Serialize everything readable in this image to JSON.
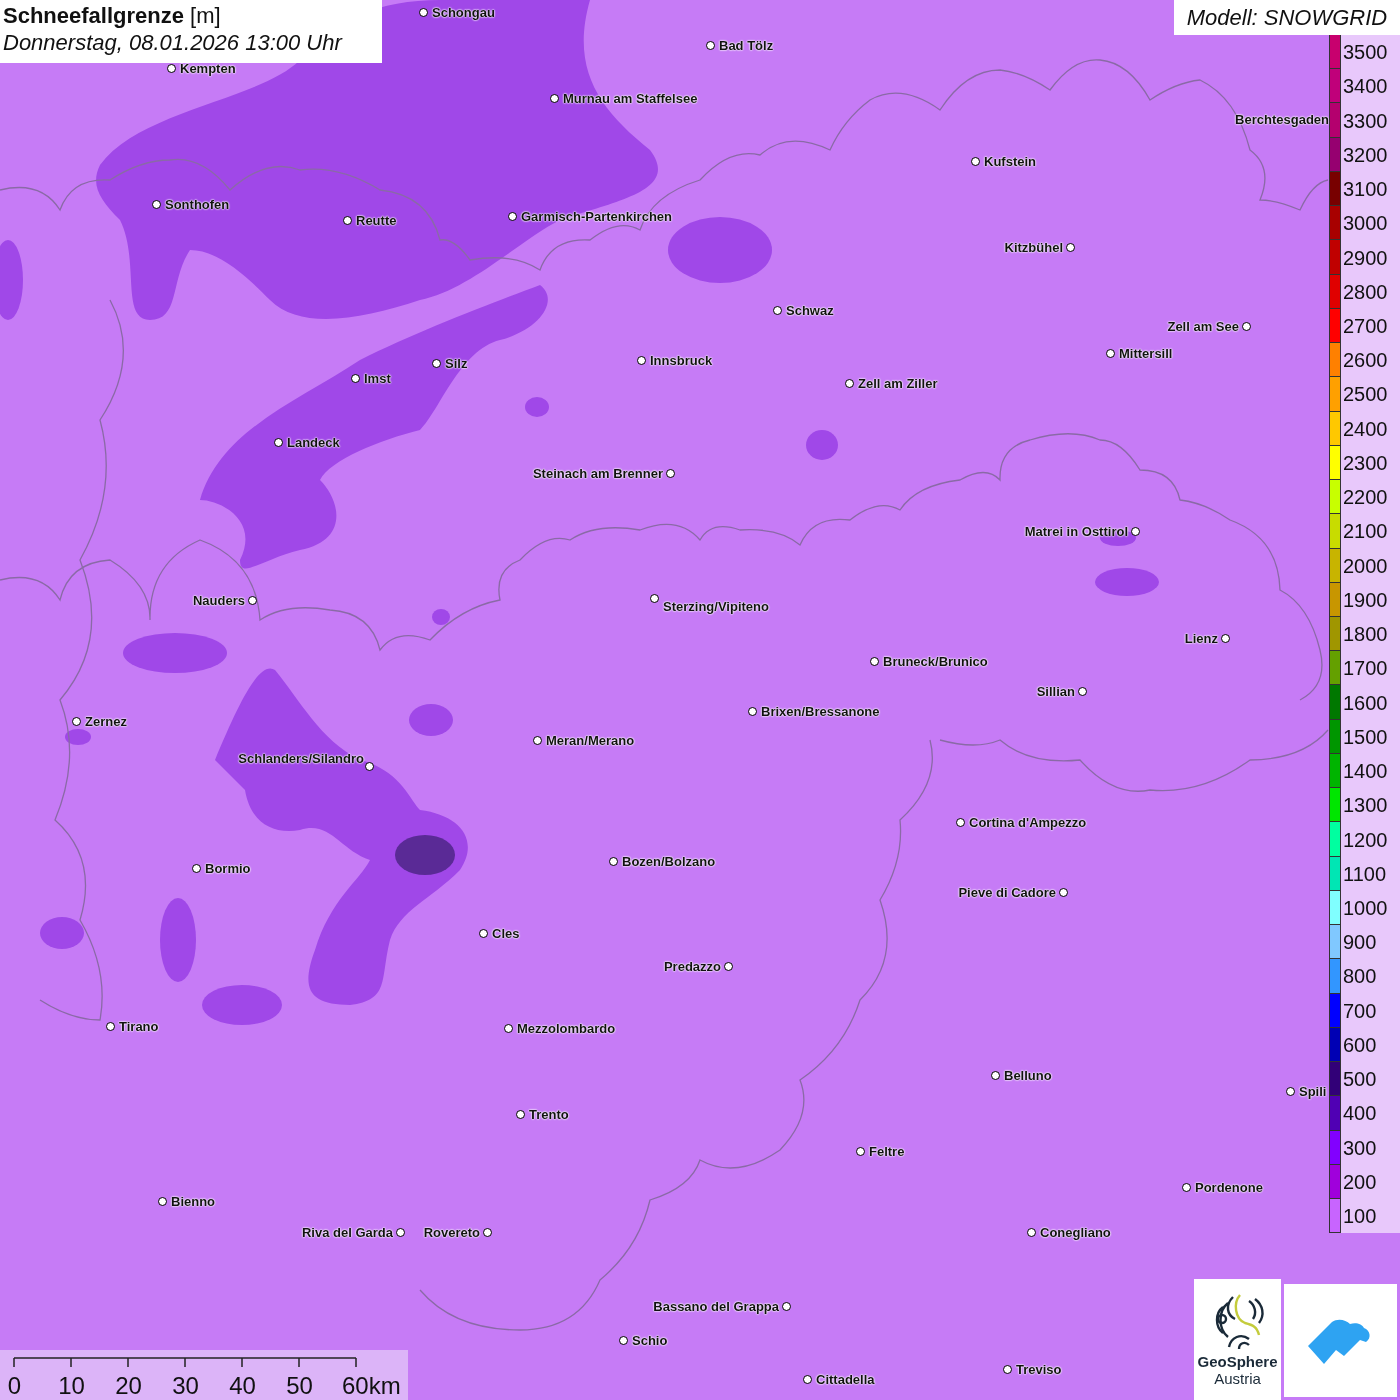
{
  "title": {
    "heading": "**Schneefallgrenze** [m]",
    "datetime": "Donnerstag, 08.01.2026 13:00 Uhr"
  },
  "model": "Modell: SNOWGRID",
  "cities": [
    {
      "name": "Schongau"
    },
    {
      "name": "Bad Tölz"
    },
    {
      "name": "Kempten"
    },
    {
      "name": "Murnau am Staffelsee"
    },
    {
      "name": "Berchtesgaden"
    },
    {
      "name": "Kufstein"
    },
    {
      "name": "Sonthofen"
    },
    {
      "name": "Reutte"
    },
    {
      "name": "Garmisch-Partenkirchen"
    },
    {
      "name": "Kitzbühel"
    },
    {
      "name": "Schwaz"
    },
    {
      "name": "Zell am See"
    },
    {
      "name": "Mittersill"
    },
    {
      "name": "Innsbruck"
    },
    {
      "name": "Silz"
    },
    {
      "name": "Imst"
    },
    {
      "name": "Zell am Ziller"
    },
    {
      "name": "Landeck"
    },
    {
      "name": "Steinach am Brenner"
    },
    {
      "name": "Matrei in Osttirol"
    },
    {
      "name": "Nauders"
    },
    {
      "name": "Sterzing/Vipiteno"
    },
    {
      "name": "Lienz"
    },
    {
      "name": "Bruneck/Brunico"
    },
    {
      "name": "Sillian"
    },
    {
      "name": "Brixen/Bressanone"
    },
    {
      "name": "Zernez"
    },
    {
      "name": "Meran/Merano"
    },
    {
      "name": "Schlanders/Silandro"
    },
    {
      "name": "Cortina d'Ampezzo"
    },
    {
      "name": "Bozen/Bolzano"
    },
    {
      "name": "Bormio"
    },
    {
      "name": "Pieve di Cadore"
    },
    {
      "name": "Cles"
    },
    {
      "name": "Predazzo"
    },
    {
      "name": "Tirano"
    },
    {
      "name": "Mezzolombardo"
    },
    {
      "name": "Belluno"
    },
    {
      "name": "Spili"
    },
    {
      "name": "Trento"
    },
    {
      "name": "Feltre"
    },
    {
      "name": "Pordenone"
    },
    {
      "name": "Bienno"
    },
    {
      "name": "Riva del Garda"
    },
    {
      "name": "Rovereto"
    },
    {
      "name": "Conegliano"
    },
    {
      "name": "Bassano del Grappa"
    },
    {
      "name": "Schio"
    },
    {
      "name": "Treviso"
    },
    {
      "name": "Cittadella"
    }
  ],
  "legend": {
    "items": [
      {
        "label": "3500",
        "color": "#c8006e"
      },
      {
        "label": "3400",
        "color": "#c0007a"
      },
      {
        "label": "3300",
        "color": "#b4006e"
      },
      {
        "label": "3200",
        "color": "#960070"
      },
      {
        "label": "3100",
        "color": "#780000"
      },
      {
        "label": "3000",
        "color": "#a80000"
      },
      {
        "label": "2900",
        "color": "#c00000"
      },
      {
        "label": "2800",
        "color": "#e00000"
      },
      {
        "label": "2700",
        "color": "#ff0000"
      },
      {
        "label": "2600",
        "color": "#ff8000"
      },
      {
        "label": "2500",
        "color": "#ffa000"
      },
      {
        "label": "2400",
        "color": "#ffc800"
      },
      {
        "label": "2300",
        "color": "#ffff00"
      },
      {
        "label": "2200",
        "color": "#c8ff00"
      },
      {
        "label": "2100",
        "color": "#c8dc00"
      },
      {
        "label": "2000",
        "color": "#c8b400"
      },
      {
        "label": "1900",
        "color": "#c89600"
      },
      {
        "label": "1800",
        "color": "#a09600"
      },
      {
        "label": "1700",
        "color": "#64a000"
      },
      {
        "label": "1600",
        "color": "#007800"
      },
      {
        "label": "1500",
        "color": "#009600"
      },
      {
        "label": "1400",
        "color": "#00b400"
      },
      {
        "label": "1300",
        "color": "#00e600"
      },
      {
        "label": "1200",
        "color": "#00ffa0"
      },
      {
        "label": "1100",
        "color": "#00e6b4"
      },
      {
        "label": "1000",
        "color": "#80ffff"
      },
      {
        "label": "900",
        "color": "#80c8ff"
      },
      {
        "label": "800",
        "color": "#3296ff"
      },
      {
        "label": "700",
        "color": "#0000ff"
      },
      {
        "label": "600",
        "color": "#0000b4"
      },
      {
        "label": "500",
        "color": "#320078"
      },
      {
        "label": "400",
        "color": "#5000b4"
      },
      {
        "label": "300",
        "color": "#8200ff"
      },
      {
        "label": "200",
        "color": "#a000dc"
      },
      {
        "label": "100",
        "color": "#c864ff"
      }
    ]
  },
  "scale_bar": {
    "ticks": [
      "0",
      "10",
      "20",
      "30",
      "40",
      "50",
      "60km"
    ]
  },
  "logo": {
    "line1": "GeoSphere",
    "line2": "Austria"
  }
}
